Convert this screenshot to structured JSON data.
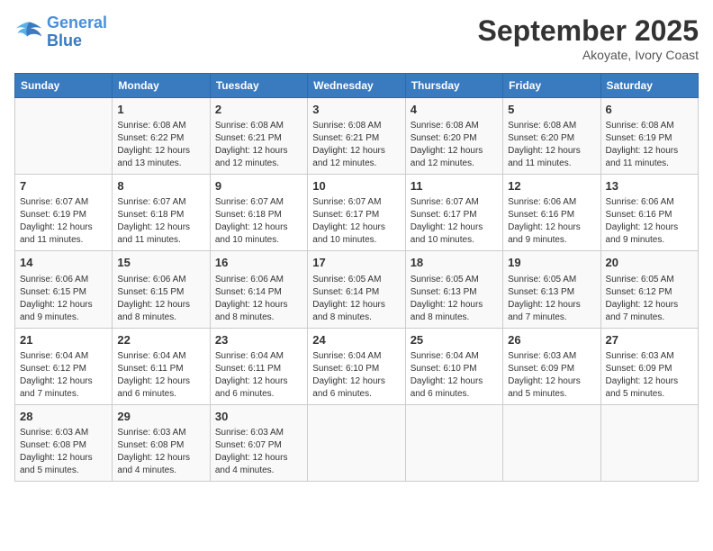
{
  "header": {
    "logo_line1": "General",
    "logo_line2": "Blue",
    "month_title": "September 2025",
    "subtitle": "Akoyate, Ivory Coast"
  },
  "days_of_week": [
    "Sunday",
    "Monday",
    "Tuesday",
    "Wednesday",
    "Thursday",
    "Friday",
    "Saturday"
  ],
  "weeks": [
    [
      {
        "day": "",
        "info": ""
      },
      {
        "day": "1",
        "info": "Sunrise: 6:08 AM\nSunset: 6:22 PM\nDaylight: 12 hours\nand 13 minutes."
      },
      {
        "day": "2",
        "info": "Sunrise: 6:08 AM\nSunset: 6:21 PM\nDaylight: 12 hours\nand 12 minutes."
      },
      {
        "day": "3",
        "info": "Sunrise: 6:08 AM\nSunset: 6:21 PM\nDaylight: 12 hours\nand 12 minutes."
      },
      {
        "day": "4",
        "info": "Sunrise: 6:08 AM\nSunset: 6:20 PM\nDaylight: 12 hours\nand 12 minutes."
      },
      {
        "day": "5",
        "info": "Sunrise: 6:08 AM\nSunset: 6:20 PM\nDaylight: 12 hours\nand 11 minutes."
      },
      {
        "day": "6",
        "info": "Sunrise: 6:08 AM\nSunset: 6:19 PM\nDaylight: 12 hours\nand 11 minutes."
      }
    ],
    [
      {
        "day": "7",
        "info": "Sunrise: 6:07 AM\nSunset: 6:19 PM\nDaylight: 12 hours\nand 11 minutes."
      },
      {
        "day": "8",
        "info": "Sunrise: 6:07 AM\nSunset: 6:18 PM\nDaylight: 12 hours\nand 11 minutes."
      },
      {
        "day": "9",
        "info": "Sunrise: 6:07 AM\nSunset: 6:18 PM\nDaylight: 12 hours\nand 10 minutes."
      },
      {
        "day": "10",
        "info": "Sunrise: 6:07 AM\nSunset: 6:17 PM\nDaylight: 12 hours\nand 10 minutes."
      },
      {
        "day": "11",
        "info": "Sunrise: 6:07 AM\nSunset: 6:17 PM\nDaylight: 12 hours\nand 10 minutes."
      },
      {
        "day": "12",
        "info": "Sunrise: 6:06 AM\nSunset: 6:16 PM\nDaylight: 12 hours\nand 9 minutes."
      },
      {
        "day": "13",
        "info": "Sunrise: 6:06 AM\nSunset: 6:16 PM\nDaylight: 12 hours\nand 9 minutes."
      }
    ],
    [
      {
        "day": "14",
        "info": "Sunrise: 6:06 AM\nSunset: 6:15 PM\nDaylight: 12 hours\nand 9 minutes."
      },
      {
        "day": "15",
        "info": "Sunrise: 6:06 AM\nSunset: 6:15 PM\nDaylight: 12 hours\nand 8 minutes."
      },
      {
        "day": "16",
        "info": "Sunrise: 6:06 AM\nSunset: 6:14 PM\nDaylight: 12 hours\nand 8 minutes."
      },
      {
        "day": "17",
        "info": "Sunrise: 6:05 AM\nSunset: 6:14 PM\nDaylight: 12 hours\nand 8 minutes."
      },
      {
        "day": "18",
        "info": "Sunrise: 6:05 AM\nSunset: 6:13 PM\nDaylight: 12 hours\nand 8 minutes."
      },
      {
        "day": "19",
        "info": "Sunrise: 6:05 AM\nSunset: 6:13 PM\nDaylight: 12 hours\nand 7 minutes."
      },
      {
        "day": "20",
        "info": "Sunrise: 6:05 AM\nSunset: 6:12 PM\nDaylight: 12 hours\nand 7 minutes."
      }
    ],
    [
      {
        "day": "21",
        "info": "Sunrise: 6:04 AM\nSunset: 6:12 PM\nDaylight: 12 hours\nand 7 minutes."
      },
      {
        "day": "22",
        "info": "Sunrise: 6:04 AM\nSunset: 6:11 PM\nDaylight: 12 hours\nand 6 minutes."
      },
      {
        "day": "23",
        "info": "Sunrise: 6:04 AM\nSunset: 6:11 PM\nDaylight: 12 hours\nand 6 minutes."
      },
      {
        "day": "24",
        "info": "Sunrise: 6:04 AM\nSunset: 6:10 PM\nDaylight: 12 hours\nand 6 minutes."
      },
      {
        "day": "25",
        "info": "Sunrise: 6:04 AM\nSunset: 6:10 PM\nDaylight: 12 hours\nand 6 minutes."
      },
      {
        "day": "26",
        "info": "Sunrise: 6:03 AM\nSunset: 6:09 PM\nDaylight: 12 hours\nand 5 minutes."
      },
      {
        "day": "27",
        "info": "Sunrise: 6:03 AM\nSunset: 6:09 PM\nDaylight: 12 hours\nand 5 minutes."
      }
    ],
    [
      {
        "day": "28",
        "info": "Sunrise: 6:03 AM\nSunset: 6:08 PM\nDaylight: 12 hours\nand 5 minutes."
      },
      {
        "day": "29",
        "info": "Sunrise: 6:03 AM\nSunset: 6:08 PM\nDaylight: 12 hours\nand 4 minutes."
      },
      {
        "day": "30",
        "info": "Sunrise: 6:03 AM\nSunset: 6:07 PM\nDaylight: 12 hours\nand 4 minutes."
      },
      {
        "day": "",
        "info": ""
      },
      {
        "day": "",
        "info": ""
      },
      {
        "day": "",
        "info": ""
      },
      {
        "day": "",
        "info": ""
      }
    ]
  ]
}
